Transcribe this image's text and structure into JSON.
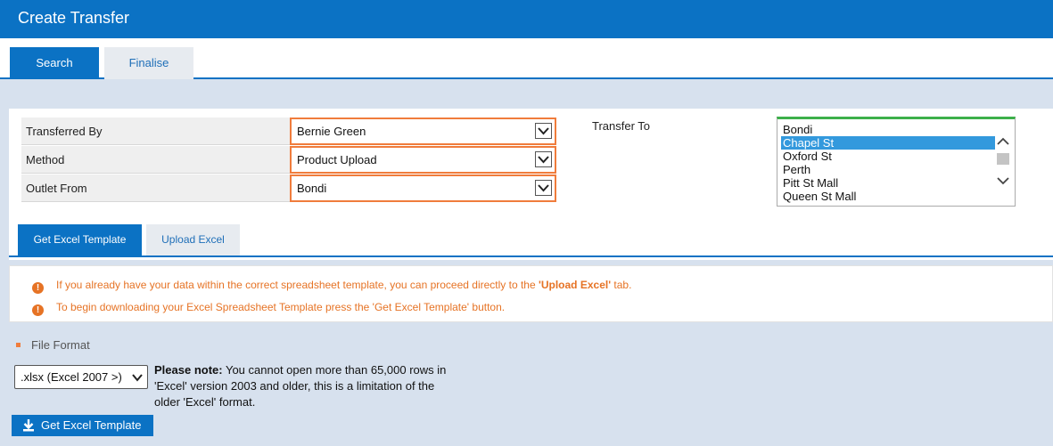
{
  "window": {
    "title": "Create Transfer"
  },
  "tabs": [
    {
      "label": "Search",
      "active": true
    },
    {
      "label": "Finalise",
      "active": false
    }
  ],
  "form": {
    "transferred_by": {
      "label": "Transferred By",
      "value": "Bernie Green"
    },
    "method": {
      "label": "Method",
      "value": "Product Upload"
    },
    "outlet_from": {
      "label": "Outlet From",
      "value": "Bondi"
    },
    "transfer_to": {
      "label": "Transfer To",
      "options": [
        "Bondi",
        "Chapel St",
        "Oxford St",
        "Perth",
        "Pitt St Mall",
        "Queen St Mall"
      ],
      "selected": "Chapel St"
    }
  },
  "subtabs": [
    {
      "label": "Get Excel Template",
      "active": true
    },
    {
      "label": "Upload Excel",
      "active": false
    }
  ],
  "notices": {
    "line1_prefix": "If you already have your data within the correct spreadsheet template, you can proceed directly to the ",
    "line1_bold": "'Upload Excel'",
    "line1_suffix": " tab.",
    "line2": "To begin downloading your Excel Spreadsheet Template press the 'Get Excel Template' button."
  },
  "file_format": {
    "label": "File Format",
    "selected": ".xlsx (Excel 2007 >)",
    "note_bold": "Please note:",
    "note_text": " You cannot open more than 65,000 rows in 'Excel' version 2003 and older, this is a limitation of the older 'Excel' format."
  },
  "buttons": {
    "get_template": "Get Excel Template"
  },
  "icons": {
    "info": "info-circle-icon",
    "chevron": "chevron-down-icon",
    "download": "download-icon",
    "scroll_up": "chevron-up-icon",
    "scroll_down": "chevron-down-icon"
  },
  "colors": {
    "primary": "#0b72c4",
    "accent_orange": "#e67325",
    "select_border": "#f07c3c",
    "selected_item": "#3399dd",
    "page_bg": "#d7e1ee"
  }
}
